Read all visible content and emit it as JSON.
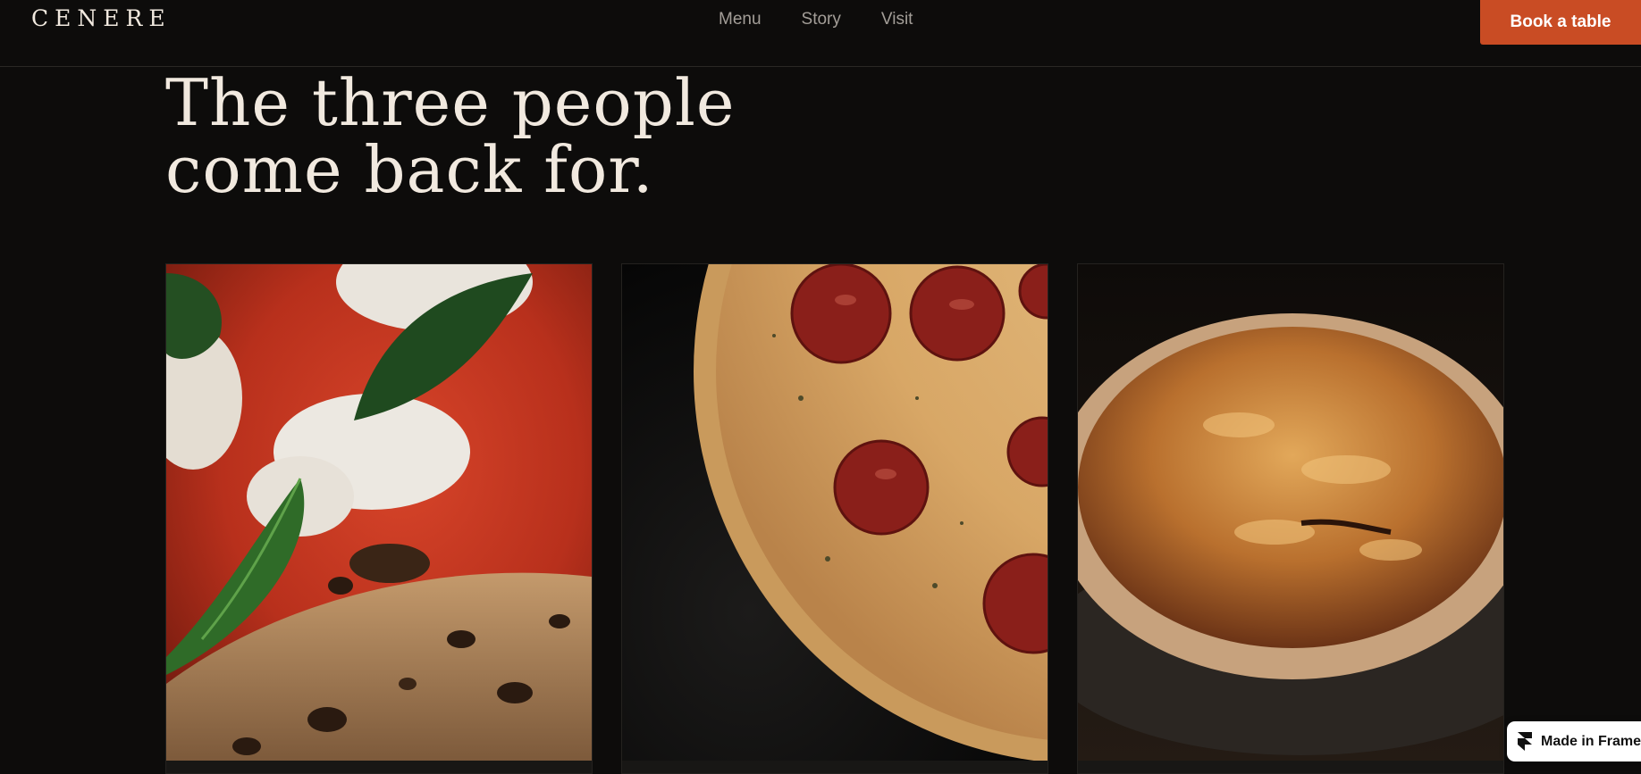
{
  "brand": {
    "logo": "CENERE"
  },
  "nav": {
    "links": [
      "Menu",
      "Story",
      "Visit"
    ],
    "cta": "Book a table"
  },
  "hero": {
    "headline_line1": "The three people",
    "headline_line2": "come back for."
  },
  "badge": {
    "label": "Made in Framer"
  },
  "colors": {
    "background": "#0d0c0b",
    "cream_text": "#f1e9df",
    "accent": "#c94c24",
    "nav_text": "#a39e98"
  }
}
